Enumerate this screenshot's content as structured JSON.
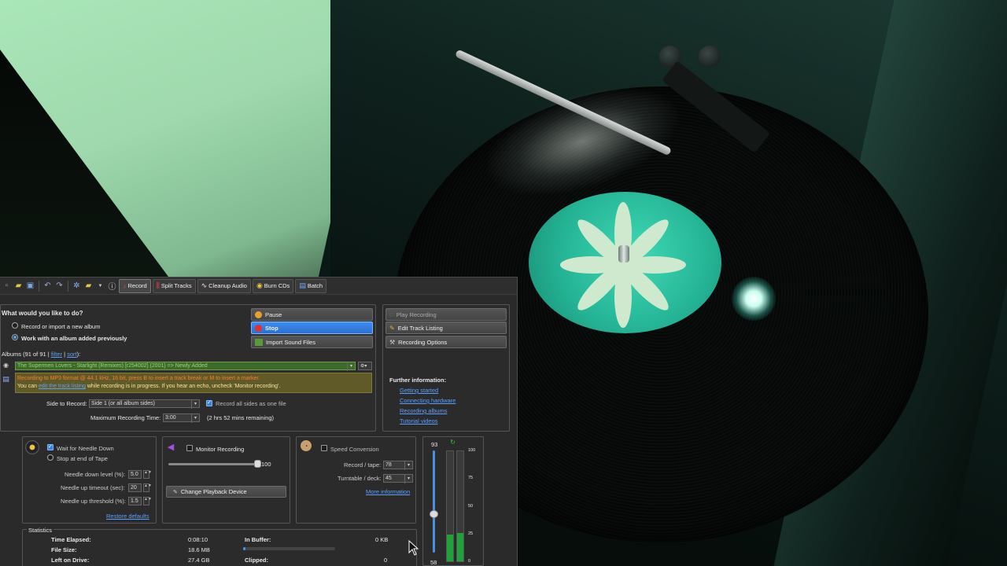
{
  "toolbar": {
    "tabs": [
      {
        "label": "Record",
        "icon": "microphone-icon"
      },
      {
        "label": "Split Tracks",
        "icon": "split-icon"
      },
      {
        "label": "Cleanup Audio",
        "icon": "waveform-icon"
      },
      {
        "label": "Burn CDs",
        "icon": "cd-icon"
      },
      {
        "label": "Batch",
        "icon": "batch-icon"
      }
    ]
  },
  "task": {
    "heading": "What would you like to do?",
    "option_new": "Record or import a new album",
    "option_previous": "Work with an album added previously",
    "selected": "option_previous"
  },
  "actions": {
    "pause": "Pause",
    "stop": "Stop",
    "import": "Import Sound Files",
    "play_recording": "Play Recording",
    "edit_track_listing": "Edit Track Listing",
    "recording_options": "Recording Options"
  },
  "albums": {
    "prefix": "Albums (91 of 91 | ",
    "filter": "filter",
    "sep": " | ",
    "sort": "sort",
    "suffix": "):",
    "selected": "The Supermen Lovers - Starlight (Remixes) [r254002] (2001) => Newly Added"
  },
  "notice": {
    "line1": "Recording to MP3 format @ 44.1 kHz, 16 bit, press B to insert a track break or M to insert a marker.",
    "line2_pre": "You can ",
    "line2_link": "edit the track listing",
    "line2_post": " while recording is in progress.  If you hear an echo, uncheck 'Monitor recording'."
  },
  "side": {
    "label": "Side to Record:",
    "value": "Side 1 (or all album sides)",
    "all_sides": "Record all sides as one file",
    "all_sides_checked": true,
    "max_time_label": "Maximum Recording Time:",
    "max_time": "3:00",
    "remaining": "(2 hrs 52 mins remaining)"
  },
  "further": {
    "heading": "Further information:",
    "links": [
      "Getting started",
      "Connecting hardware",
      "Recording albums",
      "Tutorial videos"
    ]
  },
  "needle": {
    "wait": "Wait for Needle Down",
    "wait_checked": true,
    "stop_tape": "Stop at end of Tape",
    "down_label": "Needle down level (%):",
    "down_value": "5.0",
    "timeout_label": "Needle up timeout (sec):",
    "timeout_value": "20",
    "threshold_label": "Needle up threshold (%):",
    "threshold_value": "1.5",
    "restore": "Restore defaults"
  },
  "monitor": {
    "label": "Monitor Recording",
    "checked": false,
    "volume": "100",
    "volume_fraction": 1.0,
    "change_device": "Change Playback Device"
  },
  "speed": {
    "label": "Speed Conversion",
    "checked": false,
    "record_label": "Record / tape:",
    "record_value": "78",
    "turntable_label": "Turntable / deck:",
    "turntable_value": "45",
    "more": "More information"
  },
  "levels": {
    "top": "93",
    "bottom": "58",
    "slider_fraction": 0.62,
    "scale": [
      "100",
      "75",
      "50",
      "25",
      "0"
    ],
    "left_fraction": 0.24,
    "right_fraction": 0.26
  },
  "stats": {
    "title": "Statistics",
    "elapsed_label": "Time Elapsed:",
    "elapsed": "0:08:10",
    "filesize_label": "File Size:",
    "filesize": "18.6 MB",
    "left_label": "Left on Drive:",
    "left": "27.4 GB",
    "buffer_label": "In Buffer:",
    "buffer": "0 KB",
    "clipped_label": "Clipped:",
    "clipped": "0"
  },
  "colors": {
    "accent": "#3d8cf0",
    "album_bg": "#3c6b2c",
    "notice_bg": "#5f5a28",
    "notice_text": "#ff7a30",
    "meter": "#1fa23a"
  }
}
